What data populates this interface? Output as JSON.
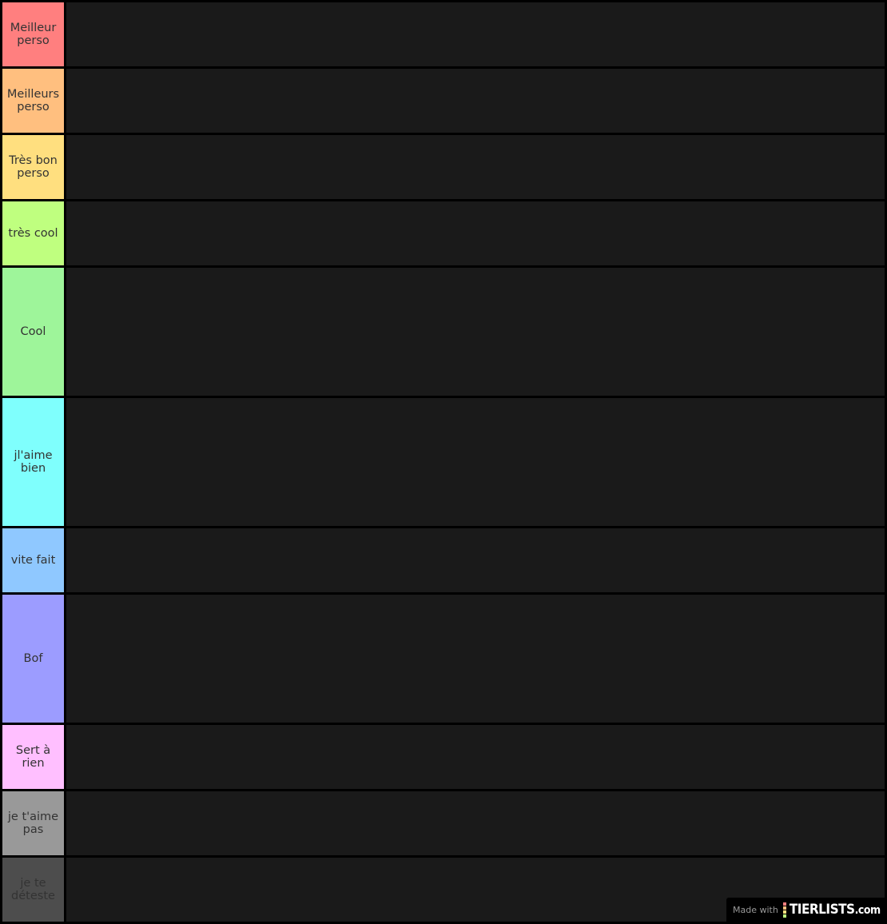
{
  "tiers": [
    {
      "label": "Meilleur perso",
      "color": "#ff7f7f",
      "text_color": "#333333",
      "size": "normal",
      "items": []
    },
    {
      "label": "Meilleurs perso",
      "color": "#ffbf7f",
      "text_color": "#333333",
      "size": "normal",
      "items": []
    },
    {
      "label": "Très bon perso",
      "color": "#ffdf7f",
      "text_color": "#333333",
      "size": "normal",
      "items": []
    },
    {
      "label": "très cool",
      "color": "#bfff7f",
      "text_color": "#333333",
      "size": "normal",
      "items": []
    },
    {
      "label": "Cool",
      "color": "#9ef59a",
      "text_color": "#333333",
      "size": "tall",
      "items": []
    },
    {
      "label": "jl'aime bien",
      "color": "#7ffffd",
      "text_color": "#333333",
      "size": "tall",
      "items": []
    },
    {
      "label": "vite fait",
      "color": "#8fc8ff",
      "text_color": "#333333",
      "size": "normal",
      "items": []
    },
    {
      "label": "Bof",
      "color": "#9c9cff",
      "text_color": "#333333",
      "size": "tall",
      "items": []
    },
    {
      "label": "Sert à rien",
      "color": "#ffbfff",
      "text_color": "#333333",
      "size": "normal",
      "items": []
    },
    {
      "label": "je t'aime pas",
      "color": "#999999",
      "text_color": "#333333",
      "size": "normal",
      "items": []
    },
    {
      "label": "je te déteste",
      "color": "#4d4d4d",
      "text_color": "#333333",
      "size": "normal",
      "items": []
    }
  ],
  "watermark": {
    "made_with": "Made with",
    "brand": "TIERLISTS",
    "brand_suffix": ".com",
    "logo_colors": [
      "#ff7f7f",
      "#ffbf7f",
      "#ffdf7f",
      "#bfff7f"
    ]
  }
}
